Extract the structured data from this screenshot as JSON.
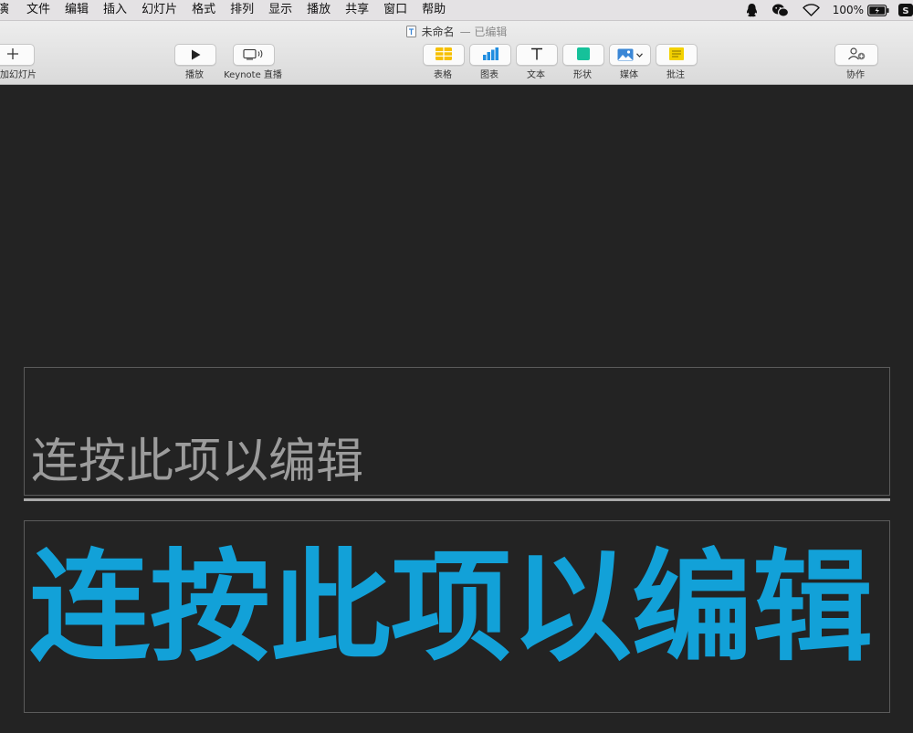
{
  "menubar": {
    "items": [
      "演",
      "文件",
      "编辑",
      "插入",
      "幻灯片",
      "格式",
      "排列",
      "显示",
      "播放",
      "共享",
      "窗口",
      "帮助"
    ],
    "status": {
      "battery_percent": "100%",
      "battery_level": 1.0
    }
  },
  "window": {
    "doc_name": "未命名",
    "doc_state": "— 已编辑"
  },
  "toolbar": {
    "add_slide_label": "加幻灯片",
    "play_label": "播放",
    "keynote_live_label": "Keynote 直播",
    "table_label": "表格",
    "chart_label": "图表",
    "text_label": "文本",
    "shape_label": "形状",
    "media_label": "媒体",
    "comment_label": "批注",
    "collaborate_label": "协作"
  },
  "slide": {
    "subtitle_placeholder": "连按此项以编辑",
    "title_placeholder": "连按此项以编辑"
  },
  "colors": {
    "canvas": "#232323",
    "title_text": "#12a1d8",
    "subtitle_text": "#9c9c9c",
    "table_icon": "#f6c000",
    "chart_icon": "#1f8de0",
    "shape_icon": "#16c19a",
    "media_icon": "#3b87d6",
    "comment_icon": "#f3d100"
  }
}
